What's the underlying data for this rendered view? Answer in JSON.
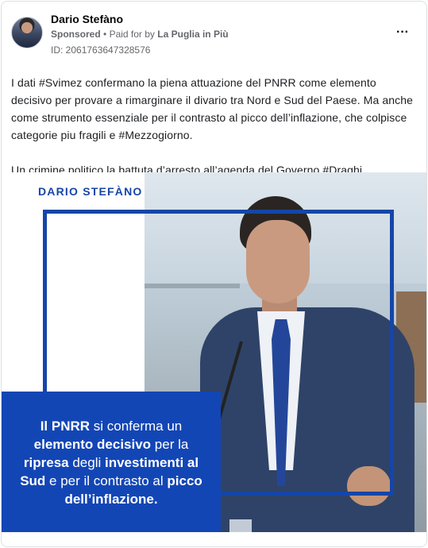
{
  "post": {
    "author": "Dario Stefàno",
    "sponsored_label": "Sponsored",
    "paid_for_prefix": "Paid for by",
    "payer": "La Puglia in Più",
    "ad_id": "ID: 2061763647328576",
    "more_icon": "···",
    "text_p1": "I dati #Svimez confermano la piena attuazione del PNRR come elemento decisivo per provare a rimarginare il divario tra Nord e Sud del Paese. Ma anche come strumento essenziale per il contrasto al picco dell’inflazione, che colpisce categorie piu fragili e #Mezzogiorno.",
    "text_p2": "Un crimine politico la battuta d’arresto all’agenda del Governo #Draghi."
  },
  "creative": {
    "brand_name": "DARIO STEFÀNO",
    "box_segments": [
      {
        "text": "Il PNRR",
        "bold": true
      },
      {
        "text": " si conferma un ",
        "bold": false
      },
      {
        "text": "elemento decisivo",
        "bold": true
      },
      {
        "text": " per la ",
        "bold": false
      },
      {
        "text": "ripresa",
        "bold": true
      },
      {
        "text": " degli ",
        "bold": false
      },
      {
        "text": "investimenti al Sud",
        "bold": true
      },
      {
        "text": " e per il contrasto al ",
        "bold": false
      },
      {
        "text": "picco dell’inflazione.",
        "bold": true
      }
    ],
    "colors": {
      "brand_blue": "#1546a8",
      "box_blue": "#1346b5"
    }
  }
}
